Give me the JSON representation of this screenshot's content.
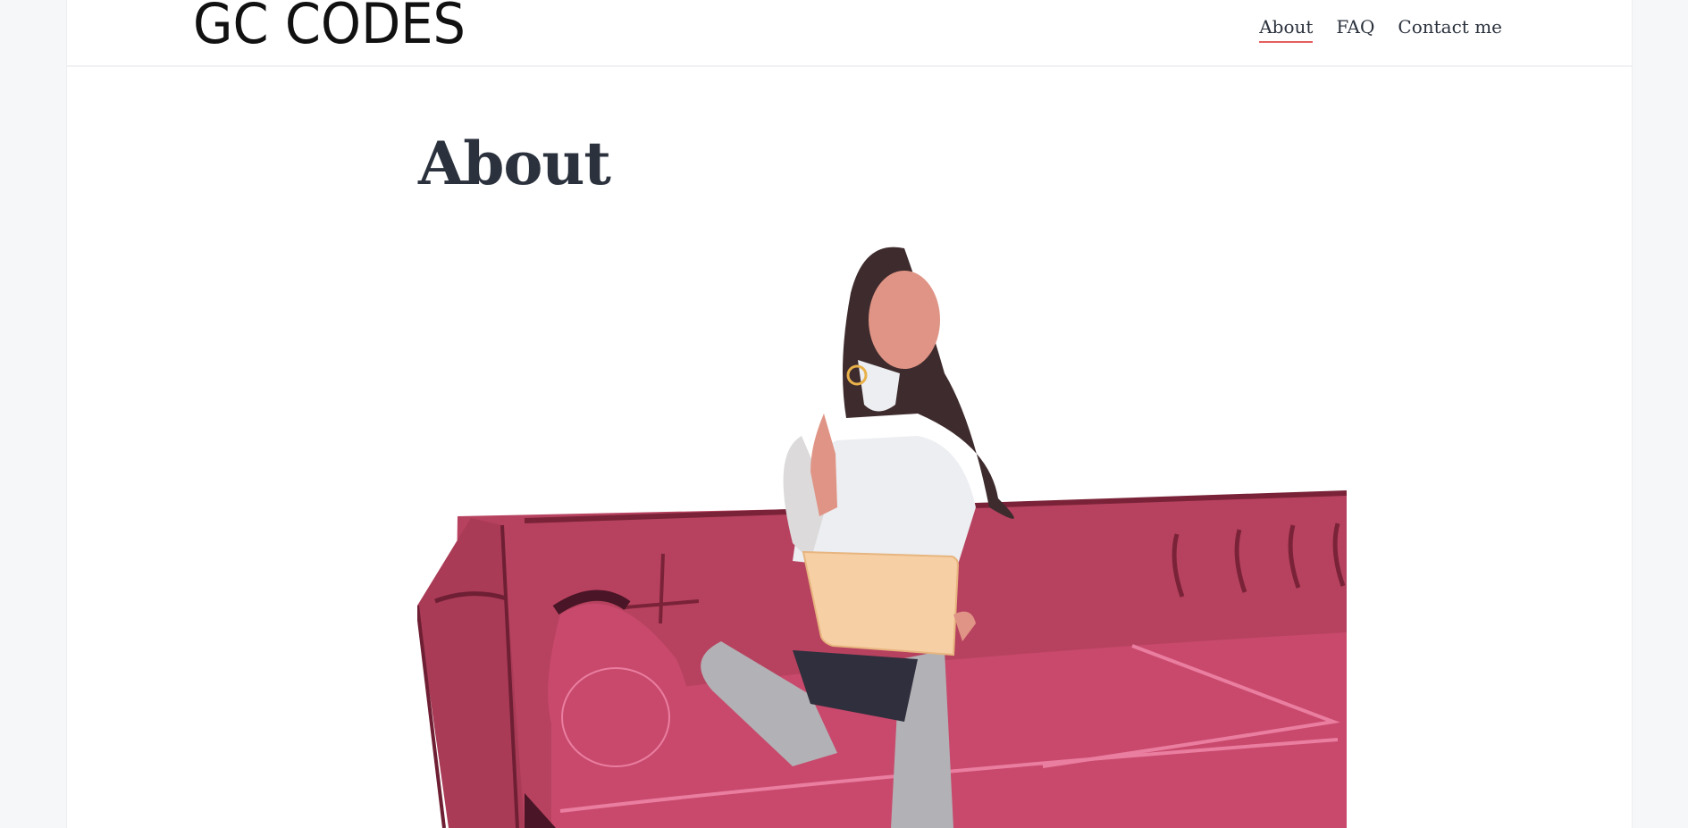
{
  "header": {
    "logo_text": "GC CODES",
    "nav": [
      {
        "label": "About",
        "active": true
      },
      {
        "label": "FAQ",
        "active": false
      },
      {
        "label": "Contact me",
        "active": false
      }
    ]
  },
  "main": {
    "title": "About"
  },
  "colors": {
    "accent_underline": "#e45f5f",
    "text": "#2b323d",
    "sofa": "#b7425f",
    "laptop": "#f7cfa4"
  }
}
